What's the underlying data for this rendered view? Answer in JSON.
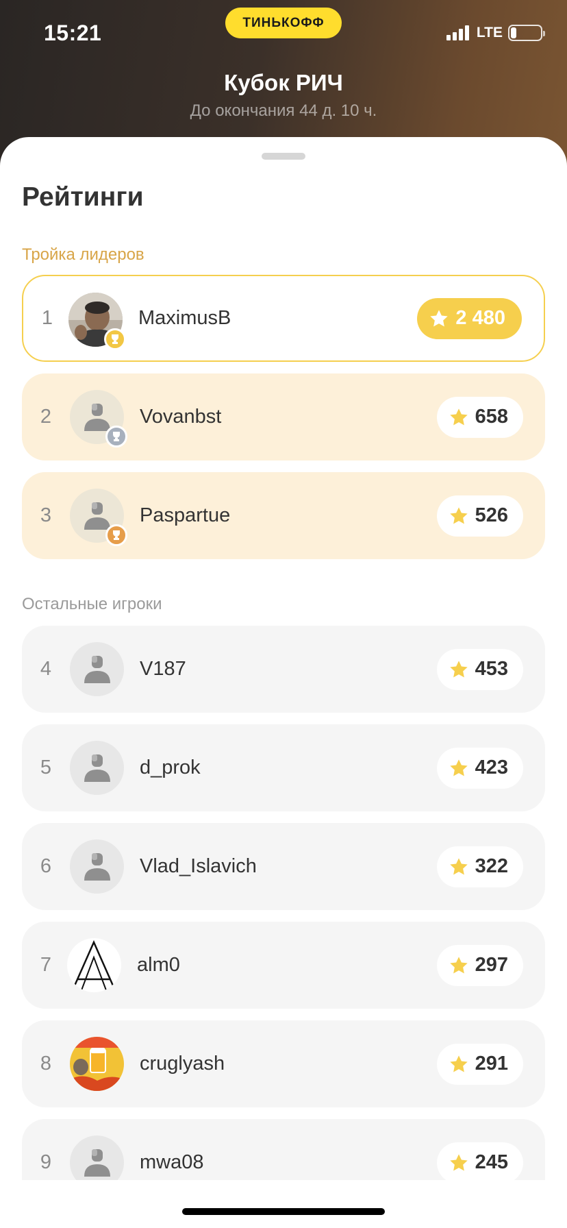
{
  "status_bar": {
    "time": "15:21",
    "network": "LTE",
    "battery_level": 0.2
  },
  "brand": {
    "label": "ТИНЬКОФФ"
  },
  "header": {
    "title": "Кубок РИЧ",
    "subtitle": "До окончания 44 д. 10 ч."
  },
  "sheet": {
    "title": "Рейтинги"
  },
  "sections": {
    "leaders_label": "Тройка лидеров",
    "others_label": "Остальные игроки"
  },
  "leaders": [
    {
      "rank": "1",
      "name": "MaximusB",
      "score": "2 480",
      "avatar": "photo-avatar",
      "medal": "gold"
    },
    {
      "rank": "2",
      "name": "Vovanbst",
      "score": "658",
      "avatar": "default-avatar",
      "medal": "silver"
    },
    {
      "rank": "3",
      "name": "Paspartue",
      "score": "526",
      "avatar": "default-avatar",
      "medal": "bronze"
    }
  ],
  "others": [
    {
      "rank": "4",
      "name": "V187",
      "score": "453",
      "avatar": "default-avatar"
    },
    {
      "rank": "5",
      "name": "d_prok",
      "score": "423",
      "avatar": "default-avatar"
    },
    {
      "rank": "6",
      "name": "Vlad_Islavich",
      "score": "322",
      "avatar": "default-avatar"
    },
    {
      "rank": "7",
      "name": "alm0",
      "score": "297",
      "avatar": "letter-a-avatar"
    },
    {
      "rank": "8",
      "name": "cruglyash",
      "score": "291",
      "avatar": "beer-photo-avatar"
    },
    {
      "rank": "9",
      "name": "mwa08",
      "score": "245",
      "avatar": "default-avatar"
    }
  ],
  "colors": {
    "accent_yellow": "#ffdd2d",
    "gold": "#f6cf4d",
    "leader_bg": "#fdf0d9",
    "other_bg": "#f5f5f5",
    "section_gold": "#d8a548"
  }
}
